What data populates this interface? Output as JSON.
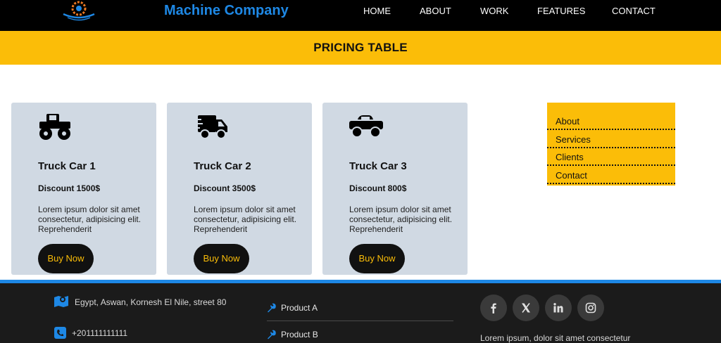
{
  "header": {
    "brand": "Machine Company",
    "nav": [
      "HOME",
      "ABOUT",
      "WORK",
      "FEATURES",
      "CONTACT"
    ]
  },
  "banner": {
    "title": "PRICING TABLE"
  },
  "cards": [
    {
      "title": "Truck Car 1",
      "discount": "Discount 1500$",
      "description": "Lorem ipsum dolor sit amet consectetur, adipisicing elit. Reprehenderit",
      "button": "Buy Now",
      "icon": "monster-truck-icon"
    },
    {
      "title": "Truck Car 2",
      "discount": "Discount 3500$",
      "description": "Lorem ipsum dolor sit amet consectetur, adipisicing elit. Reprehenderit",
      "button": "Buy Now",
      "icon": "delivery-truck-icon"
    },
    {
      "title": "Truck Car 3",
      "discount": "Discount 800$",
      "description": "Lorem ipsum dolor sit amet consectetur, adipisicing elit. Reprehenderit",
      "button": "Buy Now",
      "icon": "pickup-truck-icon"
    }
  ],
  "side_menu": [
    "About",
    "Services",
    "Clients",
    "Contact"
  ],
  "footer": {
    "address": "Egypt, Aswan, Kornesh El Nile, street 80",
    "phone": "+201111111111",
    "products": [
      "Product A",
      "Product B"
    ],
    "tagline": "Lorem ipsum, dolor sit amet consectetur",
    "social": [
      "facebook-icon",
      "x-icon",
      "linkedin-icon",
      "instagram-icon"
    ]
  },
  "colors": {
    "accent": "#fbbd08",
    "brand": "#1e88e5",
    "card": "#d0d9e3",
    "dark": "#1b1b1b"
  }
}
